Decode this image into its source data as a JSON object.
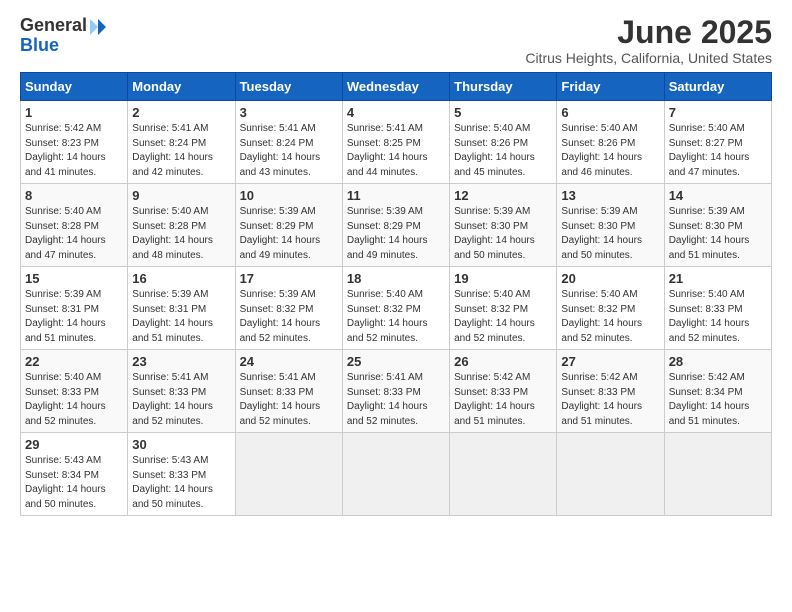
{
  "logo": {
    "general": "General",
    "blue": "Blue"
  },
  "title": "June 2025",
  "subtitle": "Citrus Heights, California, United States",
  "days": [
    "Sunday",
    "Monday",
    "Tuesday",
    "Wednesday",
    "Thursday",
    "Friday",
    "Saturday"
  ],
  "weeks": [
    [
      {
        "day": "1",
        "sunrise": "5:42 AM",
        "sunset": "8:23 PM",
        "daylight": "14 hours and 41 minutes."
      },
      {
        "day": "2",
        "sunrise": "5:41 AM",
        "sunset": "8:24 PM",
        "daylight": "14 hours and 42 minutes."
      },
      {
        "day": "3",
        "sunrise": "5:41 AM",
        "sunset": "8:24 PM",
        "daylight": "14 hours and 43 minutes."
      },
      {
        "day": "4",
        "sunrise": "5:41 AM",
        "sunset": "8:25 PM",
        "daylight": "14 hours and 44 minutes."
      },
      {
        "day": "5",
        "sunrise": "5:40 AM",
        "sunset": "8:26 PM",
        "daylight": "14 hours and 45 minutes."
      },
      {
        "day": "6",
        "sunrise": "5:40 AM",
        "sunset": "8:26 PM",
        "daylight": "14 hours and 46 minutes."
      },
      {
        "day": "7",
        "sunrise": "5:40 AM",
        "sunset": "8:27 PM",
        "daylight": "14 hours and 47 minutes."
      }
    ],
    [
      {
        "day": "8",
        "sunrise": "5:40 AM",
        "sunset": "8:28 PM",
        "daylight": "14 hours and 47 minutes."
      },
      {
        "day": "9",
        "sunrise": "5:40 AM",
        "sunset": "8:28 PM",
        "daylight": "14 hours and 48 minutes."
      },
      {
        "day": "10",
        "sunrise": "5:39 AM",
        "sunset": "8:29 PM",
        "daylight": "14 hours and 49 minutes."
      },
      {
        "day": "11",
        "sunrise": "5:39 AM",
        "sunset": "8:29 PM",
        "daylight": "14 hours and 49 minutes."
      },
      {
        "day": "12",
        "sunrise": "5:39 AM",
        "sunset": "8:30 PM",
        "daylight": "14 hours and 50 minutes."
      },
      {
        "day": "13",
        "sunrise": "5:39 AM",
        "sunset": "8:30 PM",
        "daylight": "14 hours and 50 minutes."
      },
      {
        "day": "14",
        "sunrise": "5:39 AM",
        "sunset": "8:30 PM",
        "daylight": "14 hours and 51 minutes."
      }
    ],
    [
      {
        "day": "15",
        "sunrise": "5:39 AM",
        "sunset": "8:31 PM",
        "daylight": "14 hours and 51 minutes."
      },
      {
        "day": "16",
        "sunrise": "5:39 AM",
        "sunset": "8:31 PM",
        "daylight": "14 hours and 51 minutes."
      },
      {
        "day": "17",
        "sunrise": "5:39 AM",
        "sunset": "8:32 PM",
        "daylight": "14 hours and 52 minutes."
      },
      {
        "day": "18",
        "sunrise": "5:40 AM",
        "sunset": "8:32 PM",
        "daylight": "14 hours and 52 minutes."
      },
      {
        "day": "19",
        "sunrise": "5:40 AM",
        "sunset": "8:32 PM",
        "daylight": "14 hours and 52 minutes."
      },
      {
        "day": "20",
        "sunrise": "5:40 AM",
        "sunset": "8:32 PM",
        "daylight": "14 hours and 52 minutes."
      },
      {
        "day": "21",
        "sunrise": "5:40 AM",
        "sunset": "8:33 PM",
        "daylight": "14 hours and 52 minutes."
      }
    ],
    [
      {
        "day": "22",
        "sunrise": "5:40 AM",
        "sunset": "8:33 PM",
        "daylight": "14 hours and 52 minutes."
      },
      {
        "day": "23",
        "sunrise": "5:41 AM",
        "sunset": "8:33 PM",
        "daylight": "14 hours and 52 minutes."
      },
      {
        "day": "24",
        "sunrise": "5:41 AM",
        "sunset": "8:33 PM",
        "daylight": "14 hours and 52 minutes."
      },
      {
        "day": "25",
        "sunrise": "5:41 AM",
        "sunset": "8:33 PM",
        "daylight": "14 hours and 52 minutes."
      },
      {
        "day": "26",
        "sunrise": "5:42 AM",
        "sunset": "8:33 PM",
        "daylight": "14 hours and 51 minutes."
      },
      {
        "day": "27",
        "sunrise": "5:42 AM",
        "sunset": "8:33 PM",
        "daylight": "14 hours and 51 minutes."
      },
      {
        "day": "28",
        "sunrise": "5:42 AM",
        "sunset": "8:34 PM",
        "daylight": "14 hours and 51 minutes."
      }
    ],
    [
      {
        "day": "29",
        "sunrise": "5:43 AM",
        "sunset": "8:34 PM",
        "daylight": "14 hours and 50 minutes."
      },
      {
        "day": "30",
        "sunrise": "5:43 AM",
        "sunset": "8:33 PM",
        "daylight": "14 hours and 50 minutes."
      },
      null,
      null,
      null,
      null,
      null
    ]
  ]
}
